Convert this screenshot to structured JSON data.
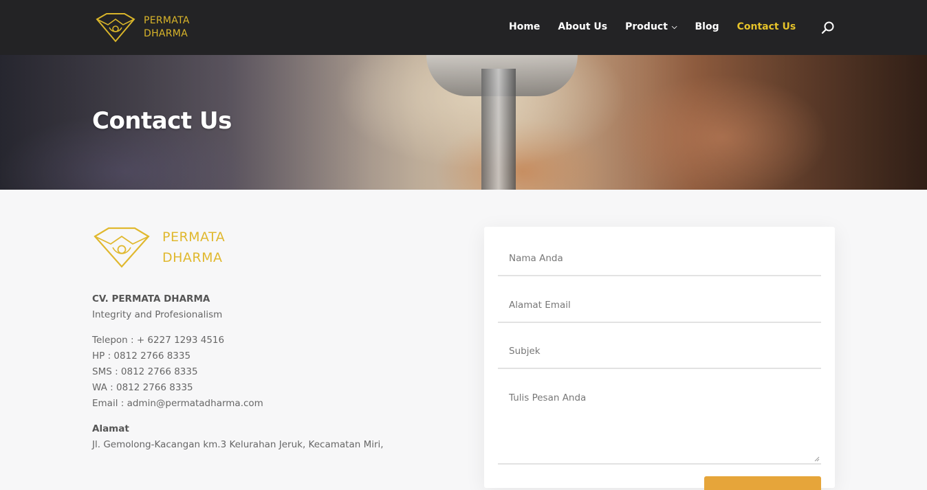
{
  "header": {
    "logo": {
      "line1": "PERMATA",
      "line2": "DHARMA",
      "icon": "diamond-logo-icon"
    },
    "nav": [
      {
        "label": "Home",
        "active": false
      },
      {
        "label": "About Us",
        "active": false
      },
      {
        "label": "Product",
        "active": false,
        "has_dropdown": true
      },
      {
        "label": "Blog",
        "active": false
      },
      {
        "label": "Contact Us",
        "active": true
      }
    ],
    "search_icon": "search-icon"
  },
  "hero": {
    "title": "Contact Us"
  },
  "info": {
    "logo": {
      "line1": "PERMATA",
      "line2": "DHARMA"
    },
    "company_name": "CV. PERMATA DHARMA",
    "tagline": "Integrity and Profesionalism",
    "contacts": [
      "Telepon : + 6227 1293 4516",
      "HP : 0812 2766 8335",
      "SMS : 0812 2766 8335",
      "WA : 0812 2766 8335",
      "Email : admin@permatadharma.com"
    ],
    "address_heading": "Alamat",
    "address_line": "Jl. Gemolong-Kacangan km.3 Kelurahan Jeruk, Kecamatan Miri,"
  },
  "form": {
    "name_placeholder": "Nama Anda",
    "email_placeholder": "Alamat Email",
    "subject_placeholder": "Subjek",
    "message_placeholder": "Tulis Pesan Anda"
  },
  "colors": {
    "header_bg": "#232325",
    "accent": "#e6c32a",
    "button": "#e6a53a"
  }
}
